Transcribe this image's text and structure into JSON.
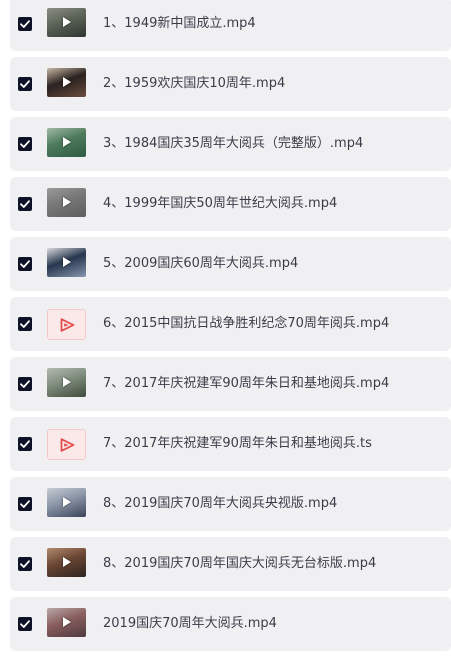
{
  "files": [
    {
      "name": "1、1949新中国成立.mp4",
      "checked": true,
      "icon": "video-thumbnail",
      "colors": [
        "#5b6357",
        "#2e3430",
        "#8c8f83"
      ]
    },
    {
      "name": "2、1959欢庆国庆10周年.mp4",
      "checked": true,
      "icon": "video-thumbnail",
      "colors": [
        "#2a2220",
        "#6b4c3e",
        "#c9b8a4"
      ]
    },
    {
      "name": "3、1984国庆35周年大阅兵（完整版）.mp4",
      "checked": true,
      "icon": "video-thumbnail",
      "colors": [
        "#4d7a5a",
        "#2f5a45",
        "#9fb9a8"
      ]
    },
    {
      "name": "4、1999年国庆50周年世纪大阅兵.mp4",
      "checked": true,
      "icon": "video-thumbnail",
      "colors": [
        "#777777",
        "#5e5e5e",
        "#9a9a9a"
      ]
    },
    {
      "name": "5、2009国庆60周年大阅兵.mp4",
      "checked": true,
      "icon": "video-thumbnail",
      "colors": [
        "#27364e",
        "#8796ad",
        "#d9d9dd"
      ]
    },
    {
      "name": "6、2015中国抗日战争胜利纪念70周年阅兵.mp4",
      "checked": true,
      "icon": "video-file-icon",
      "colors": [
        "#fbe9e9",
        "#e14d4d",
        "#f3c9c9"
      ]
    },
    {
      "name": "7、2017年庆祝建军90周年朱日和基地阅兵.mp4",
      "checked": true,
      "icon": "video-thumbnail",
      "colors": [
        "#7f8d7e",
        "#3f4b3a",
        "#b4bbb0"
      ]
    },
    {
      "name": "7、2017年庆祝建军90周年朱日和基地阅兵.ts",
      "checked": true,
      "icon": "video-file-icon",
      "colors": [
        "#fbe9e9",
        "#e14d4d",
        "#f3c9c9"
      ]
    },
    {
      "name": "8、2019国庆70周年大阅兵央视版.mp4",
      "checked": true,
      "icon": "video-thumbnail",
      "colors": [
        "#8b96a8",
        "#3a4456",
        "#c7ccd3"
      ]
    },
    {
      "name": "8、2019国庆70周年国庆大阅兵无台标版.mp4",
      "checked": true,
      "icon": "video-thumbnail",
      "colors": [
        "#6a4634",
        "#2c2420",
        "#b08b70"
      ]
    },
    {
      "name": "2019国庆70周年大阅兵.mp4",
      "checked": true,
      "icon": "video-thumbnail",
      "colors": [
        "#8a5e5e",
        "#4e3a3e",
        "#b9a7a7"
      ]
    }
  ]
}
